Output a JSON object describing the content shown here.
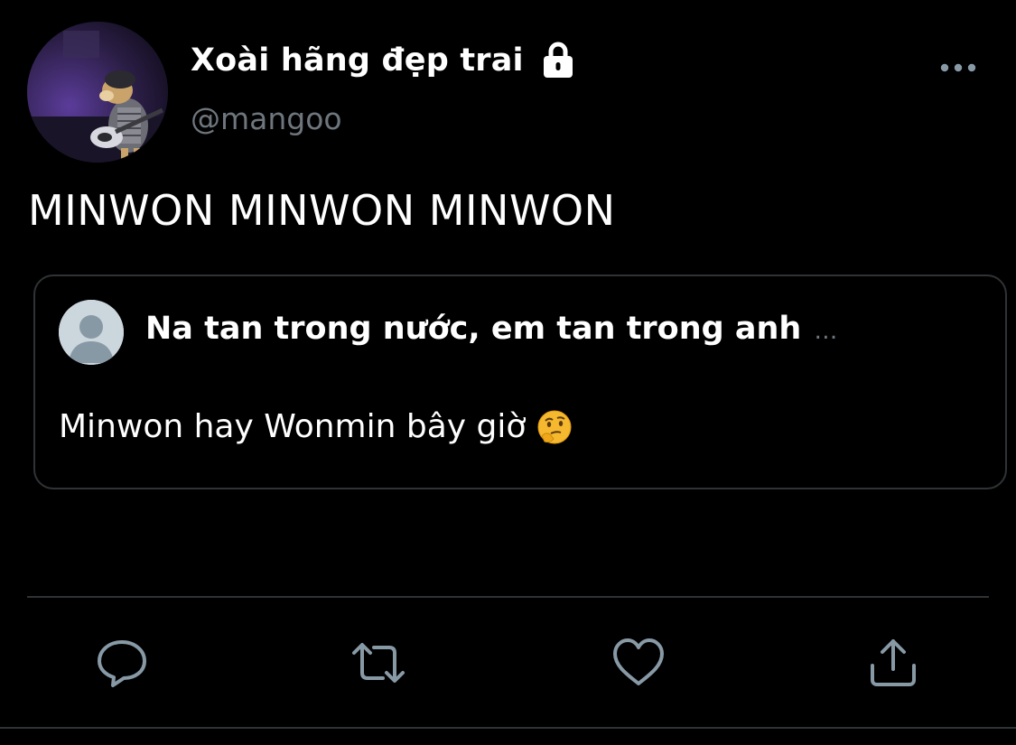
{
  "author": {
    "display_name": "Xoài hãng đẹp trai",
    "handle": "@mangoo",
    "protected_icon": "lock-icon",
    "avatar_icon": "dog-with-guitar-avatar"
  },
  "tweet": {
    "text": "MINWON MINWON MINWON"
  },
  "quote": {
    "author_name": "Na tan trong nước, em tan trong anh",
    "truncation": "…",
    "text": "Minwon hay Wonmin bây giờ",
    "emoji_icon": "thinking-face-icon",
    "avatar_icon": "default-profile-icon"
  },
  "actions": [
    {
      "icon": "reply-icon"
    },
    {
      "icon": "retweet-icon"
    },
    {
      "icon": "like-icon"
    },
    {
      "icon": "share-icon"
    }
  ],
  "colors": {
    "background": "#000000",
    "primary_text": "#ffffff",
    "secondary_text": "#6e767d",
    "border": "#2f3336",
    "action_icon": "#8899a6"
  }
}
